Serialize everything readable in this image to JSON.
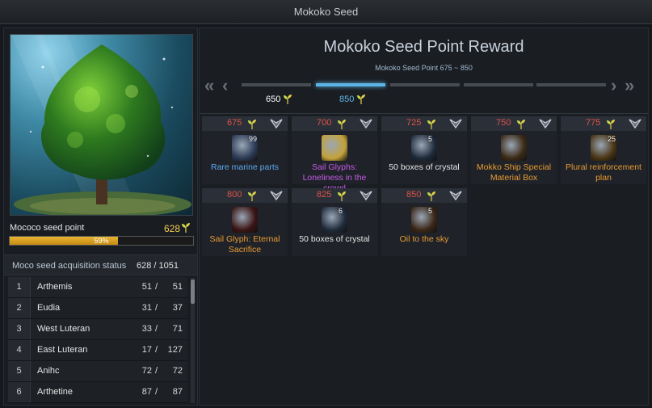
{
  "window": {
    "title": "Mokoko Seed"
  },
  "left": {
    "seed_point_label": "Mococo seed point",
    "seed_point_value": "628",
    "progress": {
      "fraction": 0.59,
      "text": "59%"
    },
    "acquisition": {
      "title": "Moco seed acquisition status",
      "total": "628  /  1051",
      "rows": [
        {
          "num": "1",
          "name": "Arthemis",
          "have": "51",
          "sep": "/",
          "max": "51"
        },
        {
          "num": "2",
          "name": "Eudia",
          "have": "31",
          "sep": "/",
          "max": "37"
        },
        {
          "num": "3",
          "name": "West Luteran",
          "have": "33",
          "sep": "/",
          "max": "71"
        },
        {
          "num": "4",
          "name": "East Luteran",
          "have": "17",
          "sep": "/",
          "max": "127"
        },
        {
          "num": "5",
          "name": "Anihc",
          "have": "72",
          "sep": "/",
          "max": "72"
        },
        {
          "num": "6",
          "name": "Arthetine",
          "have": "87",
          "sep": "/",
          "max": "87"
        }
      ]
    }
  },
  "right": {
    "title": "Mokoko Seed Point Reward",
    "subtitle": "Mokoko Seed Point 675 ~ 850",
    "tier_labels": [
      {
        "text": "650",
        "color": "#ffffff"
      },
      {
        "text": "850",
        "color": "#5fb6ea"
      }
    ],
    "rewards": [
      {
        "cost": "675",
        "name": "Rare marine parts",
        "qty": "99",
        "name_color": "#5fa8f0",
        "icon": "gear-parts-icon",
        "icon_bg": "#2b3a55"
      },
      {
        "cost": "700",
        "name": "Sail Glyphs: Loneliness in the crowd",
        "qty": "",
        "name_color": "#c55ae6",
        "icon": "glyph-icon",
        "icon_bg": "#c4a13a"
      },
      {
        "cost": "725",
        "name": "50 boxes of crystal",
        "qty": "5",
        "name_color": "#e6e6e6",
        "icon": "crystal-box-icon",
        "icon_bg": "#1f2a3a"
      },
      {
        "cost": "750",
        "name": "Mokko Ship Special Material Box",
        "qty": "",
        "name_color": "#e89b32",
        "icon": "chest-icon",
        "icon_bg": "#3c2a16"
      },
      {
        "cost": "775",
        "name": "Plural reinforcement plan",
        "qty": "25",
        "name_color": "#e89b32",
        "icon": "scroll-plan-icon",
        "icon_bg": "#4a3414"
      },
      {
        "cost": "800",
        "name": "Sail Glyph: Eternal Sacrifice",
        "qty": "",
        "name_color": "#e89b32",
        "icon": "eternal-glyph-icon",
        "icon_bg": "#3a1414"
      },
      {
        "cost": "825",
        "name": "50 boxes of crystal",
        "qty": "6",
        "name_color": "#e6e6e6",
        "icon": "crystal-box-icon",
        "icon_bg": "#1f2a3a"
      },
      {
        "cost": "850",
        "name": "Oil to the sky",
        "qty": "5",
        "name_color": "#e89b32",
        "icon": "oil-flask-icon",
        "icon_bg": "#3a2616"
      }
    ]
  }
}
